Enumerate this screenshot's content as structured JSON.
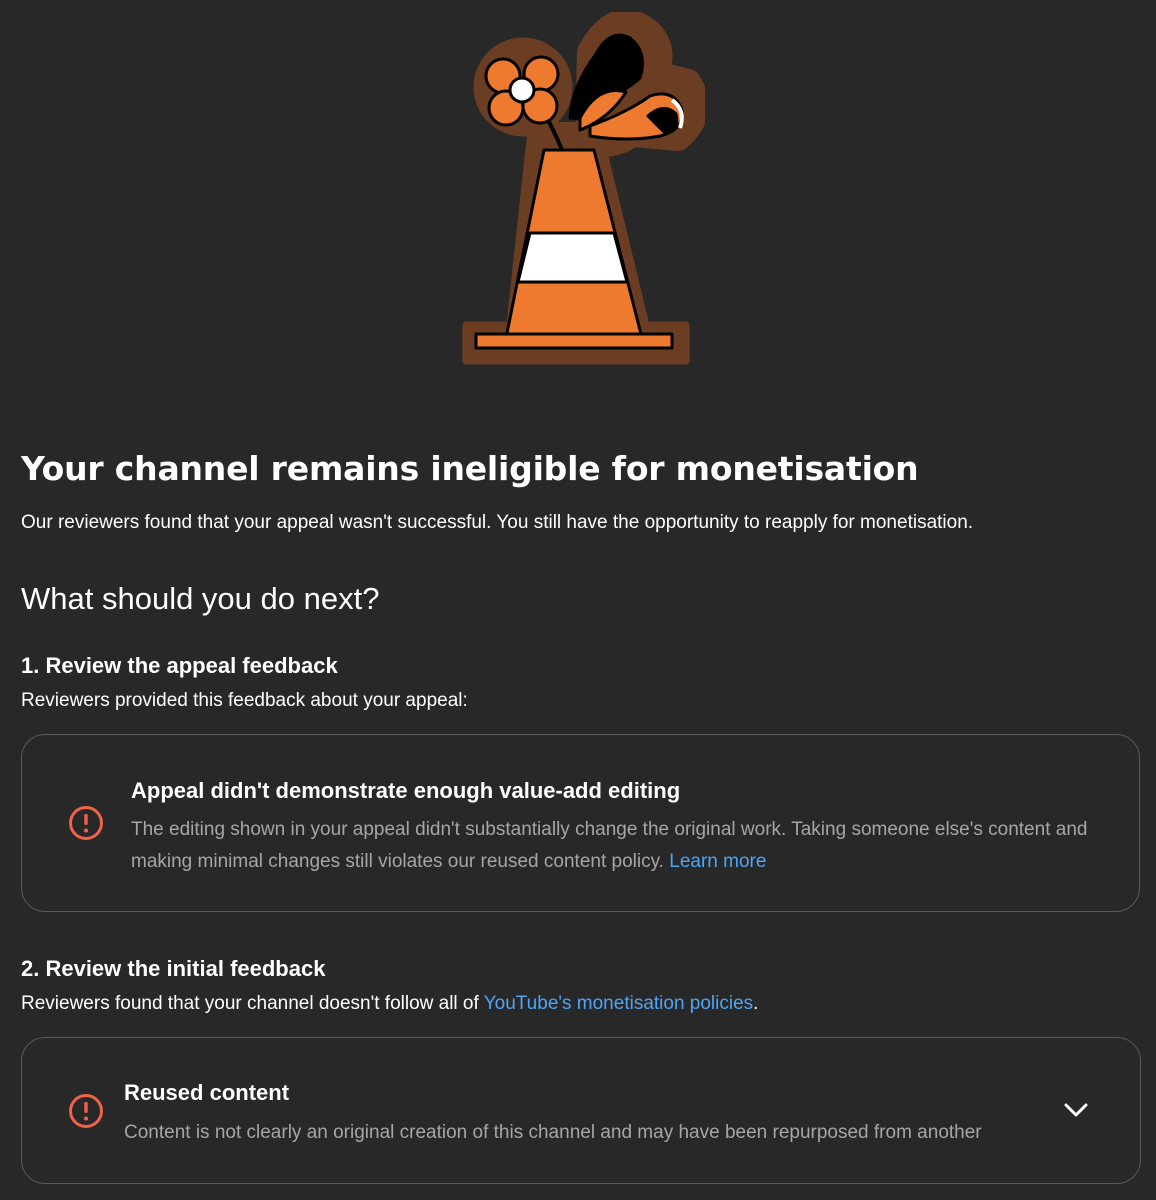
{
  "header": {
    "title": "Your channel remains ineligible for monetisation",
    "intro": "Our reviewers found that your appeal wasn't successful. You still have the opportunity to reapply for monetisation."
  },
  "next_steps": {
    "heading": "What should you do next?",
    "step1": {
      "title": "1. Review the appeal feedback",
      "description": "Reviewers provided this feedback about your appeal:",
      "card": {
        "icon": "alert-circle-icon",
        "title": "Appeal didn't demonstrate enough value-add editing",
        "body": "The editing shown in your appeal didn't substantially change the original work. Taking someone else's content and making minimal changes still violates our reused content policy.",
        "link_label": "Learn more"
      }
    },
    "step2": {
      "title": "2. Review the initial feedback",
      "description_prefix": "Reviewers found that your channel doesn't follow all of",
      "link_label": "YouTube's monetisation policies",
      "description_suffix": ".",
      "card": {
        "icon": "alert-circle-icon",
        "title": "Reused content",
        "body": "Content is not clearly an original creation of this channel and may have been repurposed from another",
        "expand_icon": "chevron-down-icon"
      }
    }
  },
  "colors": {
    "background": "#282828",
    "text_primary": "#ffffff",
    "text_secondary": "#a6a6a6",
    "link": "#4ea4f5",
    "alert": "#f0624a",
    "card_border": "#5a5a5a",
    "cone_orange": "#ee7a30",
    "cone_outline_brown": "#6b3d22"
  }
}
